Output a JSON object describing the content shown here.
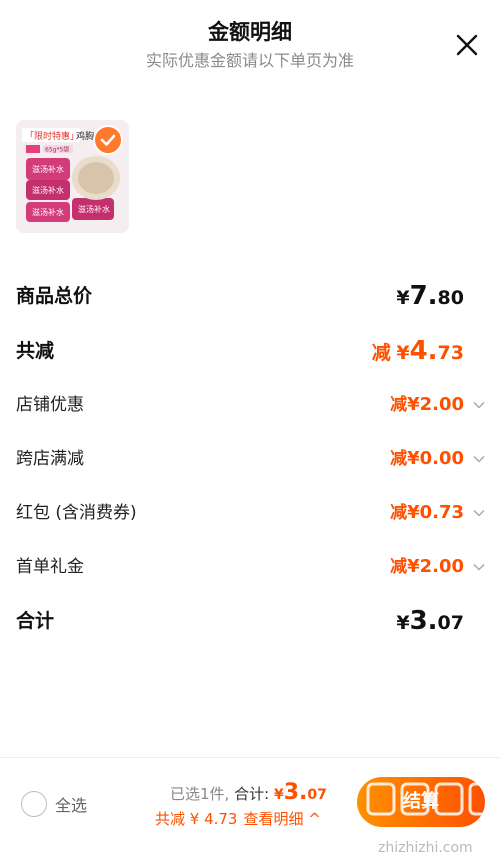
{
  "header": {
    "title": "金额明细",
    "subtitle": "实际优惠金额请以下单页为准"
  },
  "product": {
    "badge_text": "「限时特惠」",
    "name_partial": "鸡胸",
    "spec": "65g*5袋",
    "can_label": "滋汤补水"
  },
  "rows": {
    "total_price": {
      "label": "商品总价",
      "currency": "¥",
      "int": "7.",
      "dec": "80"
    },
    "total_reduce": {
      "label": "共减",
      "prefix": "减",
      "currency": "¥",
      "int": "4.",
      "dec": "73"
    },
    "store_discount": {
      "label": "店铺优惠",
      "prefix": "减",
      "amount": "¥2.00"
    },
    "cross_store": {
      "label": "跨店满减",
      "prefix": "减",
      "amount": "¥0.00"
    },
    "red_packet": {
      "label": "红包 (含消费券)",
      "prefix": "减",
      "amount": "¥0.73"
    },
    "first_order": {
      "label": "首单礼金",
      "prefix": "减",
      "amount": "¥2.00"
    },
    "sum": {
      "label": "合计",
      "currency": "¥",
      "int": "3.",
      "dec": "07"
    }
  },
  "bottom": {
    "select_all": "全选",
    "selected_count": "已选1件,",
    "total_label": "合计:",
    "total_currency": "¥",
    "total_int": "3.",
    "total_dec": "07",
    "reduce_text": "共减 ¥ 4.73",
    "view_detail": "查看明细 ^",
    "checkout_label": "结算"
  },
  "watermark": {
    "text": "zhizhizhi.com"
  },
  "colors": {
    "accent": "#ff5000",
    "checkout_start": "#ff9000",
    "checkout_end": "#ff5000"
  }
}
